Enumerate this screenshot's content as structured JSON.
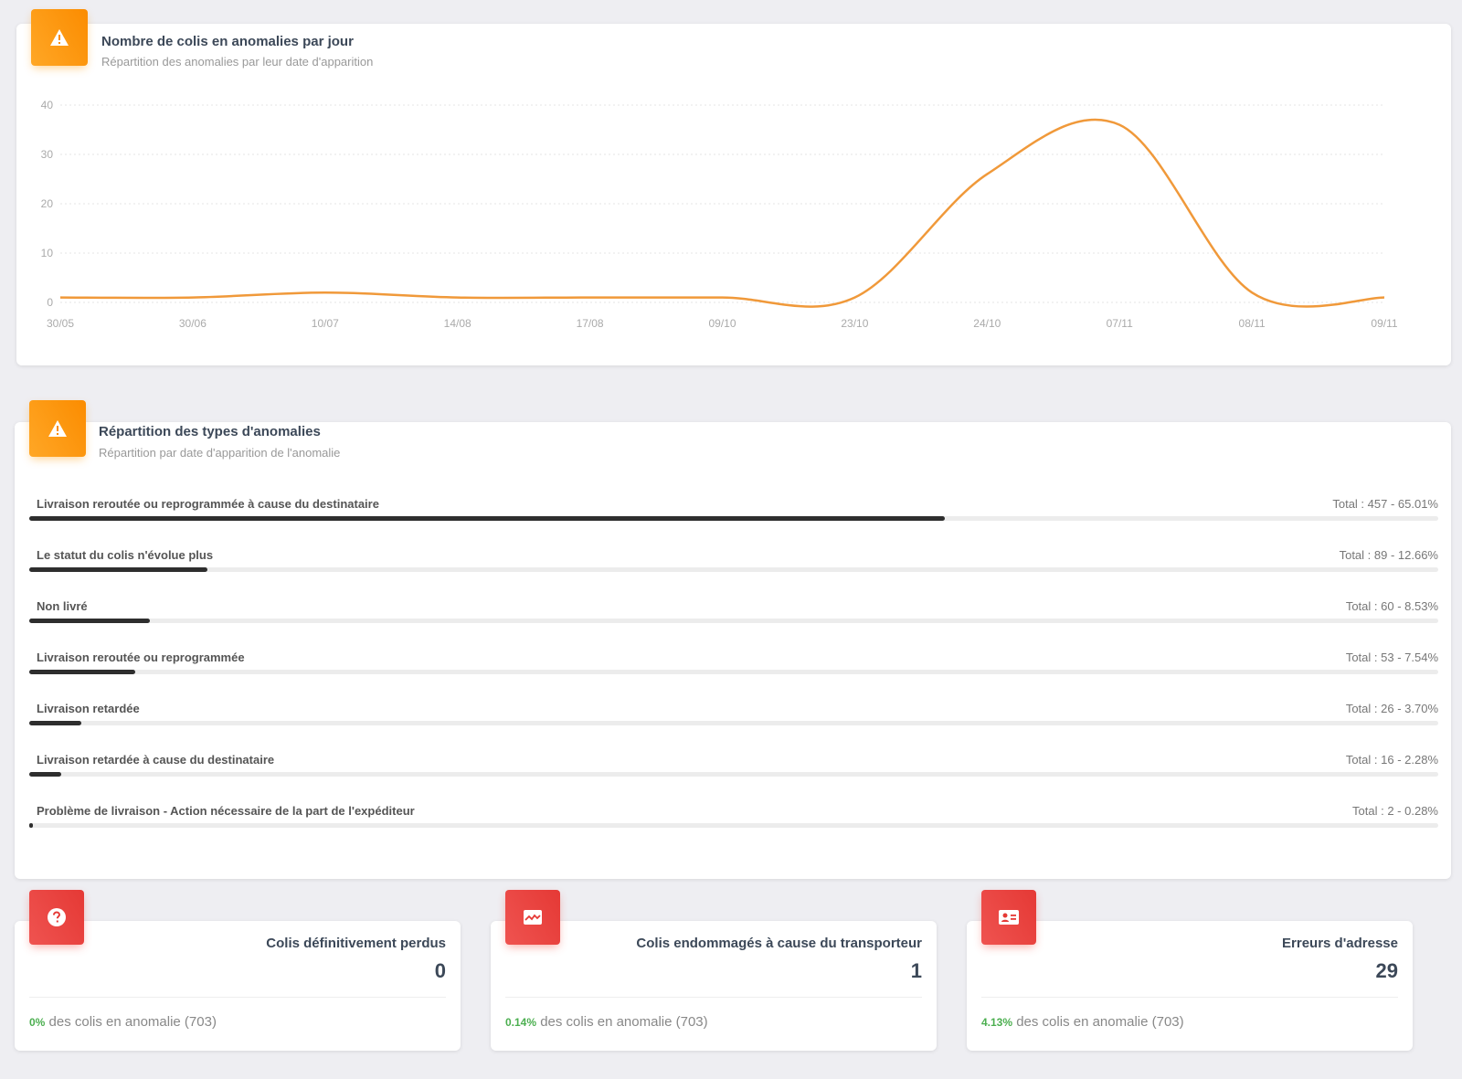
{
  "colors": {
    "accent_orange": "#fb8c00",
    "accent_red": "#e53935",
    "line_color": "#f0993a",
    "bar_color": "#2e2e2e",
    "positive_green": "#4caf50"
  },
  "chart_card": {
    "icon": "warning-icon",
    "title": "Nombre de colis en anomalies par jour",
    "subtitle": "Répartition des anomalies par leur date d'apparition"
  },
  "chart_data": {
    "type": "line",
    "title": "Nombre de colis en anomalies par jour",
    "xlabel": "",
    "ylabel": "",
    "ylim": [
      0,
      40
    ],
    "yticks": [
      0,
      10,
      20,
      30,
      40
    ],
    "x": [
      "30/05",
      "30/06",
      "10/07",
      "14/08",
      "17/08",
      "09/10",
      "23/10",
      "24/10",
      "07/11",
      "08/11",
      "09/11"
    ],
    "series": [
      {
        "values": [
          1,
          1,
          2,
          1,
          1,
          1,
          1,
          26,
          36,
          2,
          1
        ]
      }
    ],
    "grid": true,
    "curve": "smooth"
  },
  "types_card": {
    "icon": "warning-icon",
    "title": "Répartition des types d'anomalies",
    "subtitle": "Répartition par date d'apparition de l'anomalie",
    "items": [
      {
        "label": "Livraison reroutée ou reprogrammée à cause du destinataire",
        "total": "Total : 457 - 65.01%",
        "percent": 65.01
      },
      {
        "label": "Le statut du colis n'évolue plus",
        "total": "Total : 89 - 12.66%",
        "percent": 12.66
      },
      {
        "label": "Non livré",
        "total": "Total : 60 - 8.53%",
        "percent": 8.53
      },
      {
        "label": "Livraison reroutée ou reprogrammée",
        "total": "Total : 53 - 7.54%",
        "percent": 7.54
      },
      {
        "label": "Livraison retardée",
        "total": "Total : 26 - 3.70%",
        "percent": 3.7
      },
      {
        "label": "Livraison retardée à cause du destinataire",
        "total": "Total : 16 - 2.28%",
        "percent": 2.28
      },
      {
        "label": "Problème de livraison - Action nécessaire de la part de l'expéditeur",
        "total": "Total : 2 - 0.28%",
        "percent": 0.28
      }
    ]
  },
  "stats": [
    {
      "icon": "question-circle-icon",
      "title": "Colis définitivement perdus",
      "value": "0",
      "pct": "0%",
      "footer": "des colis en anomalie (703)"
    },
    {
      "icon": "broken-image-icon",
      "title": "Colis endommagés à cause du transporteur",
      "value": "1",
      "pct": "0.14%",
      "footer": "des colis en anomalie (703)"
    },
    {
      "icon": "contact-card-icon",
      "title": "Erreurs d'adresse",
      "value": "29",
      "pct": "4.13%",
      "footer": "des colis en anomalie (703)"
    }
  ]
}
